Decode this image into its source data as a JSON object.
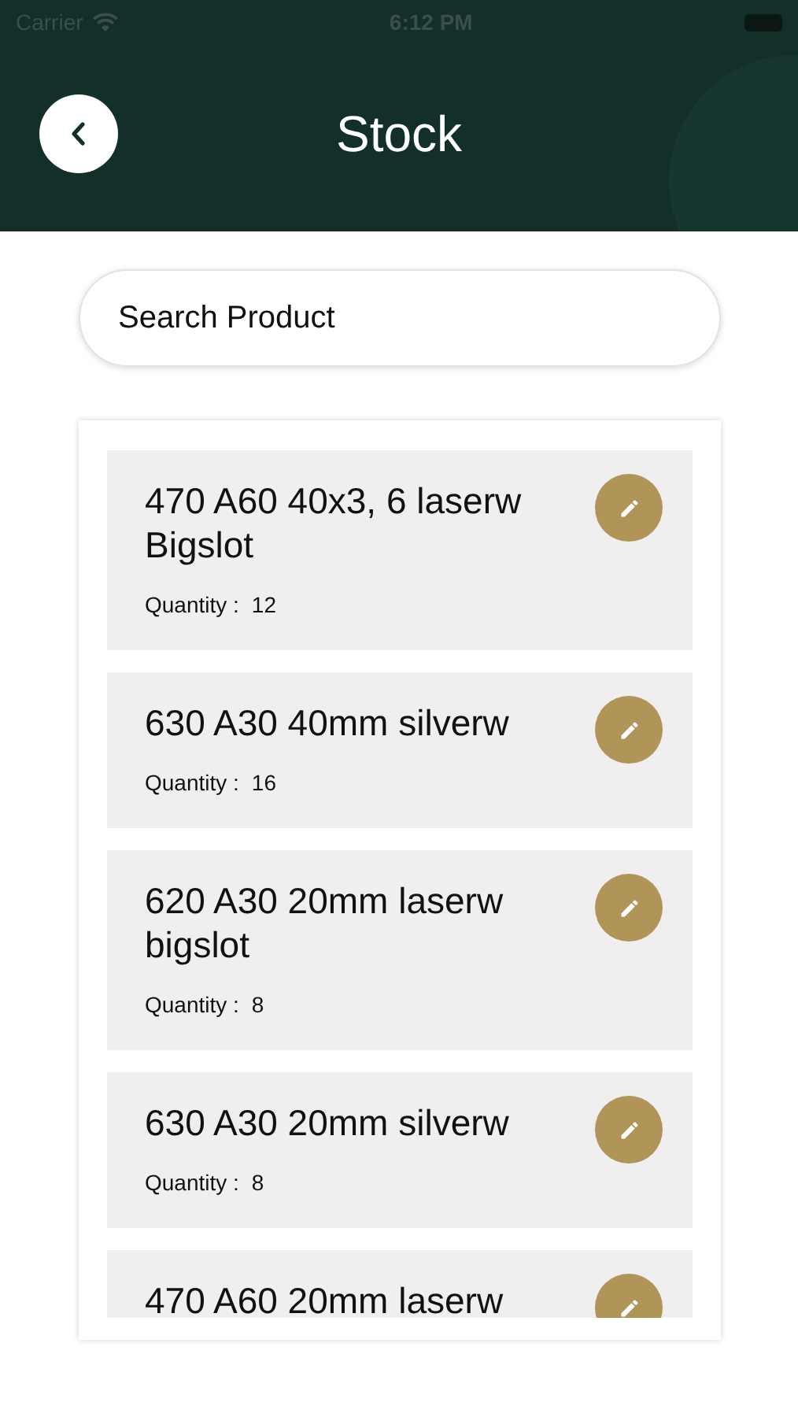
{
  "status_bar": {
    "carrier": "Carrier",
    "time": "6:12 PM"
  },
  "header": {
    "title": "Stock"
  },
  "search": {
    "placeholder": "Search Product"
  },
  "products": [
    {
      "name": "470 A60 40x3, 6 laserw Bigslot",
      "quantity_label": "Quantity :",
      "quantity": "12"
    },
    {
      "name": "630 A30 40mm silverw",
      "quantity_label": "Quantity :",
      "quantity": "16"
    },
    {
      "name": "620 A30 20mm laserw bigslot",
      "quantity_label": "Quantity :",
      "quantity": "8"
    },
    {
      "name": "630 A30 20mm silverw",
      "quantity_label": "Quantity :",
      "quantity": "8"
    },
    {
      "name": "470 A60 20mm laserw"
    }
  ]
}
